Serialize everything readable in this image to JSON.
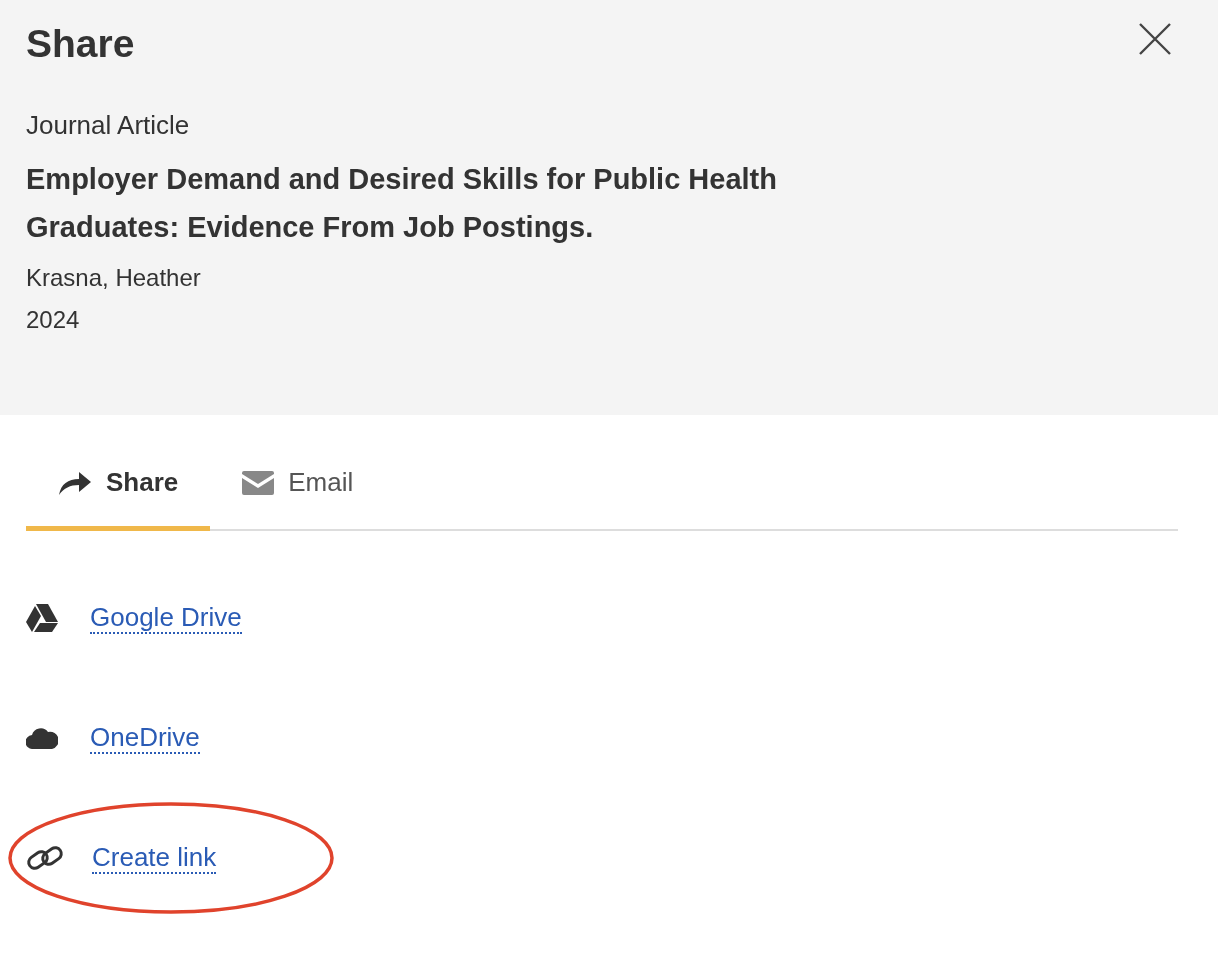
{
  "dialog": {
    "title": "Share"
  },
  "item": {
    "type": "Journal Article",
    "title": "Employer Demand and Desired Skills for Public Health Graduates: Evidence From Job Postings.",
    "author": "Krasna, Heather",
    "year": "2024"
  },
  "tabs": [
    {
      "label": "Share",
      "kind": "share",
      "selected": true
    },
    {
      "label": "Email",
      "kind": "email",
      "selected": false
    }
  ],
  "share_options": [
    {
      "label": "Google Drive",
      "kind": "drive",
      "highlighted": false
    },
    {
      "label": "OneDrive",
      "kind": "cloud",
      "highlighted": false
    },
    {
      "label": "Create link",
      "kind": "link",
      "highlighted": true
    }
  ]
}
